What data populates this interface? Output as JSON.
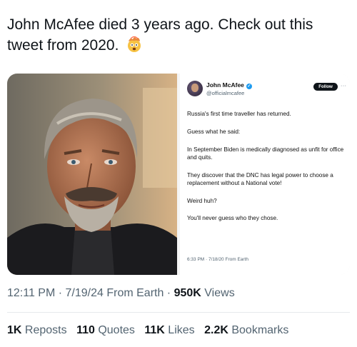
{
  "post": {
    "headline": "John McAfee died 3 years ago. Check out this tweet from 2020.",
    "emoji": "exploding-head-emoji"
  },
  "embedded_tweet": {
    "author_name": "John McAfee",
    "verified_mark": "✓",
    "author_handle": "@officialmcafee",
    "follow_label": "Follow",
    "more_label": "···",
    "paragraphs": [
      "Russia's first time traveller has returned.",
      "Guess what he said:",
      "In September Biden is medically diagnosed as unfit for office and quits.",
      "They discover that the DNC has legal power to choose a replacement without a National vote!",
      "Weird huh?",
      "You'll never guess who they chose."
    ],
    "timestamp": "6:33 PM · 7/18/20 From Earth"
  },
  "meta": {
    "time": "12:11 PM · 7/19/24 From Earth ·",
    "views_count": "950K",
    "views_label": "Views"
  },
  "stats": [
    {
      "count": "1K",
      "label": "Reposts"
    },
    {
      "count": "110",
      "label": "Quotes"
    },
    {
      "count": "11K",
      "label": "Likes"
    },
    {
      "count": "2.2K",
      "label": "Bookmarks"
    }
  ]
}
